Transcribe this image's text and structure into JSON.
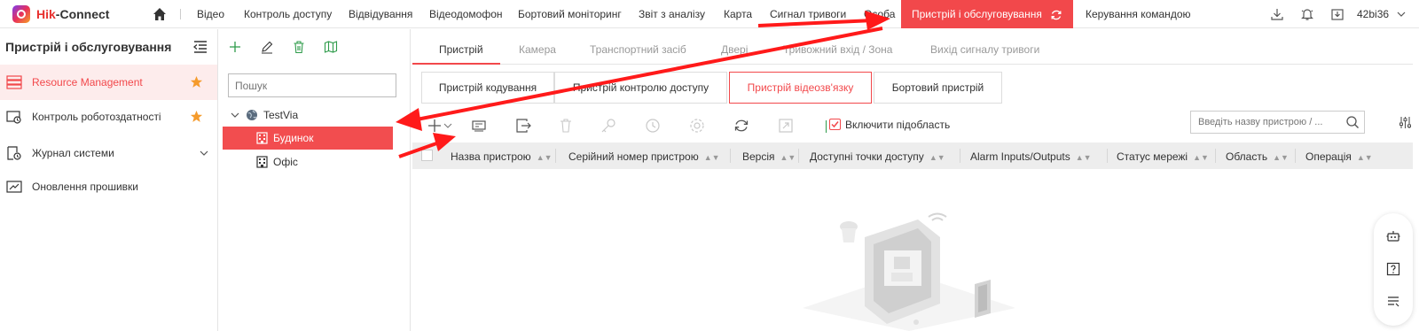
{
  "app": {
    "name_prefix": "Hik",
    "name_suffix": "-Connect"
  },
  "nav": {
    "items": [
      "Відео",
      "Контроль доступу",
      "Відвідування",
      "Відеодомофон",
      "Бортовий моніторинг",
      "Звіт з аналізу",
      "Карта",
      "Сигнал тривоги",
      "Особа"
    ],
    "active": "Пристрій і обслуговування",
    "after": "Керування командою",
    "user": "42bi36"
  },
  "sidebar": {
    "title": "Пристрій і обслуговування",
    "items": [
      {
        "label": "Resource Management",
        "icon": "resource-icon",
        "starred": true
      },
      {
        "label": "Контроль роботоздатності",
        "icon": "health-monitor-icon",
        "starred": true
      },
      {
        "label": "Журнал системи",
        "icon": "system-log-icon",
        "expandable": true
      },
      {
        "label": "Оновлення прошивки",
        "icon": "firmware-icon"
      }
    ]
  },
  "tree": {
    "search_placeholder": "Пошук",
    "root": "TestVia",
    "children": [
      "Будинок",
      "Офіс"
    ],
    "selected": "Будинок"
  },
  "main": {
    "tabs": [
      "Пристрій",
      "Камера",
      "Транспортний засіб",
      "Двері",
      "Тривожний вхід / Зона",
      "Вихід сигналу тривоги"
    ],
    "active_tab": "Пристрій",
    "subtabs": [
      "Пристрій кодування",
      "Пристрій контролю доступу",
      "Пристрій відеозв'язку",
      "Бортовий пристрій"
    ],
    "active_subtab": "Пристрій відеозв'язку",
    "include_subarea_label": "Включити підобласть",
    "include_subarea_checked": true,
    "device_search_placeholder": "Введіть назву пристрою / ...",
    "columns": [
      "Назва пристрою",
      "Серійний номер пристрою",
      "Версія",
      "Доступні точки доступу",
      "Alarm Inputs/Outputs",
      "Статус мережі",
      "Область",
      "Операція"
    ]
  },
  "colors": {
    "accent": "#f2484b",
    "annotation_arrow": "#ff1a1a"
  }
}
